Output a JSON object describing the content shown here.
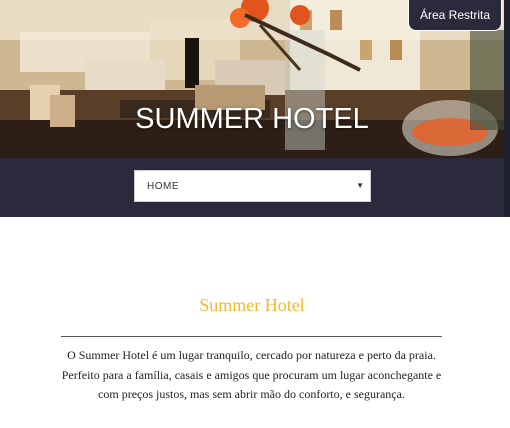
{
  "header": {
    "hotel_name": "SUMMER HOTEL",
    "restricted_area_label": "Área Restrita",
    "hero_image": "hotel-lobby-photo"
  },
  "nav": {
    "selected_value": "HOME",
    "caret_icon": "chevron-down-icon"
  },
  "content": {
    "title": "Summer Hotel",
    "description": "O Summer Hotel é um lugar tranquilo, cercado por natureza e perto da praia.  Perfeito para a família, casais e amigos que procuram um lugar aconchegante e com preços justos, mas sem abrir mão do conforto, e segurança."
  },
  "colors": {
    "navbar": "#2a2a3c",
    "title_accent": "#f5b82e",
    "text": "#222222"
  }
}
